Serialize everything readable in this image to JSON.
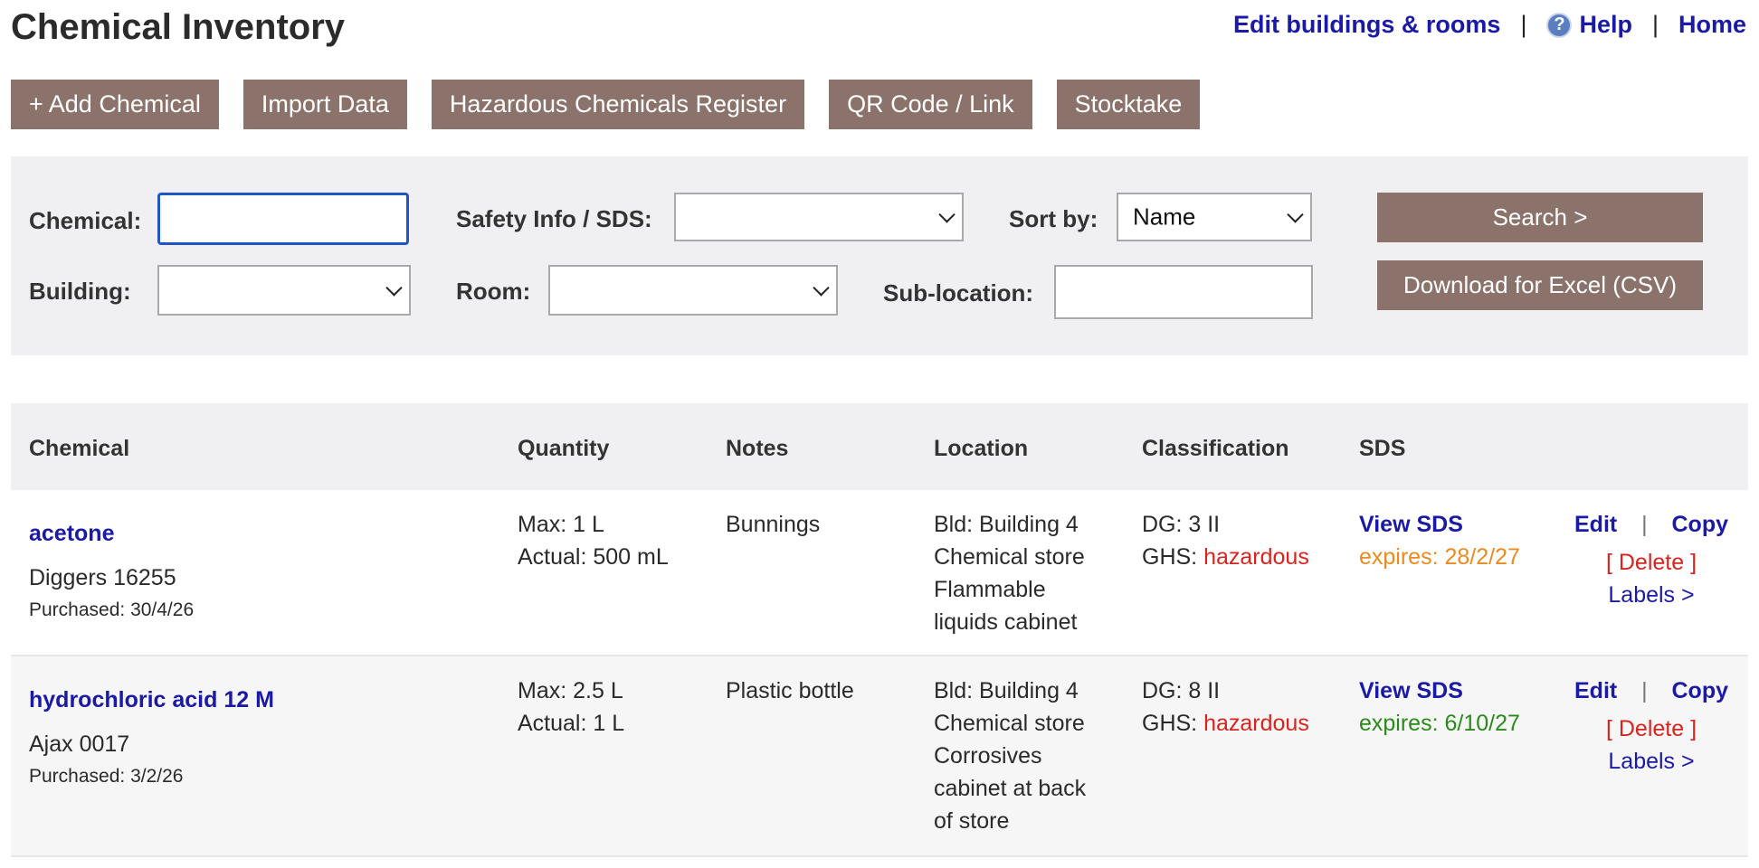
{
  "page": {
    "title": "Chemical Inventory"
  },
  "toplinks": {
    "edit_buildings": "Edit buildings & rooms",
    "separator": "|",
    "help_icon_glyph": "?",
    "help": "Help",
    "home": "Home"
  },
  "toolbar": {
    "add_chemical": "+ Add Chemical",
    "import_data": "Import Data",
    "hazardous_register": "Hazardous Chemicals Register",
    "qr_code": "QR Code / Link",
    "stocktake": "Stocktake"
  },
  "filters": {
    "chemical_label": "Chemical:",
    "chemical_value": "",
    "safety_label": "Safety Info / SDS:",
    "safety_value": "",
    "sort_label": "Sort by:",
    "sort_value": "Name",
    "building_label": "Building:",
    "building_value": "",
    "room_label": "Room:",
    "room_value": "",
    "sublocation_label": "Sub-location:",
    "sublocation_value": "",
    "search_button": "Search >",
    "download_button": "Download for Excel (CSV)"
  },
  "table": {
    "headers": {
      "chemical": "Chemical",
      "quantity": "Quantity",
      "notes": "Notes",
      "location": "Location",
      "classification": "Classification",
      "sds": "SDS"
    },
    "rows": [
      {
        "name": "acetone",
        "supplier": "Diggers 16255",
        "purchased": "Purchased: 30/4/26",
        "qty_max": "Max: 1 L",
        "qty_actual": "Actual: 500 mL",
        "notes": "Bunnings",
        "loc1": "Bld: Building 4",
        "loc2": "Chemical store",
        "loc3": "Flammable",
        "loc4": "liquids cabinet",
        "dg": "DG: 3 II",
        "ghs_label": "GHS: ",
        "ghs_value": "hazardous",
        "sds_link": "View SDS",
        "sds_expires": "expires: 28/2/27",
        "edit": "Edit",
        "pipe": "|",
        "copy": "Copy",
        "delete": "[ Delete ]",
        "labels": "Labels >"
      },
      {
        "name": "hydrochloric acid 12 M",
        "supplier": "Ajax 0017",
        "purchased": "Purchased: 3/2/26",
        "qty_max": "Max: 2.5 L",
        "qty_actual": "Actual: 1 L",
        "notes": "Plastic bottle",
        "loc1": "Bld: Building 4",
        "loc2": "Chemical store",
        "loc3": "Corrosives",
        "loc4": "cabinet at back",
        "loc5": "of store",
        "dg": "DG: 8 II",
        "ghs_label": "GHS: ",
        "ghs_value": "hazardous",
        "sds_link": "View SDS",
        "sds_expires": "expires: 6/10/27",
        "edit": "Edit",
        "pipe": "|",
        "copy": "Copy",
        "delete": "[ Delete ]",
        "labels": "Labels >"
      }
    ]
  },
  "colors": {
    "link": "#1a1aa6",
    "button": "#8b726b",
    "hazard": "#d9231e",
    "expires_soon": "#ec8a1f",
    "expires_ok": "#2a8a1a"
  }
}
